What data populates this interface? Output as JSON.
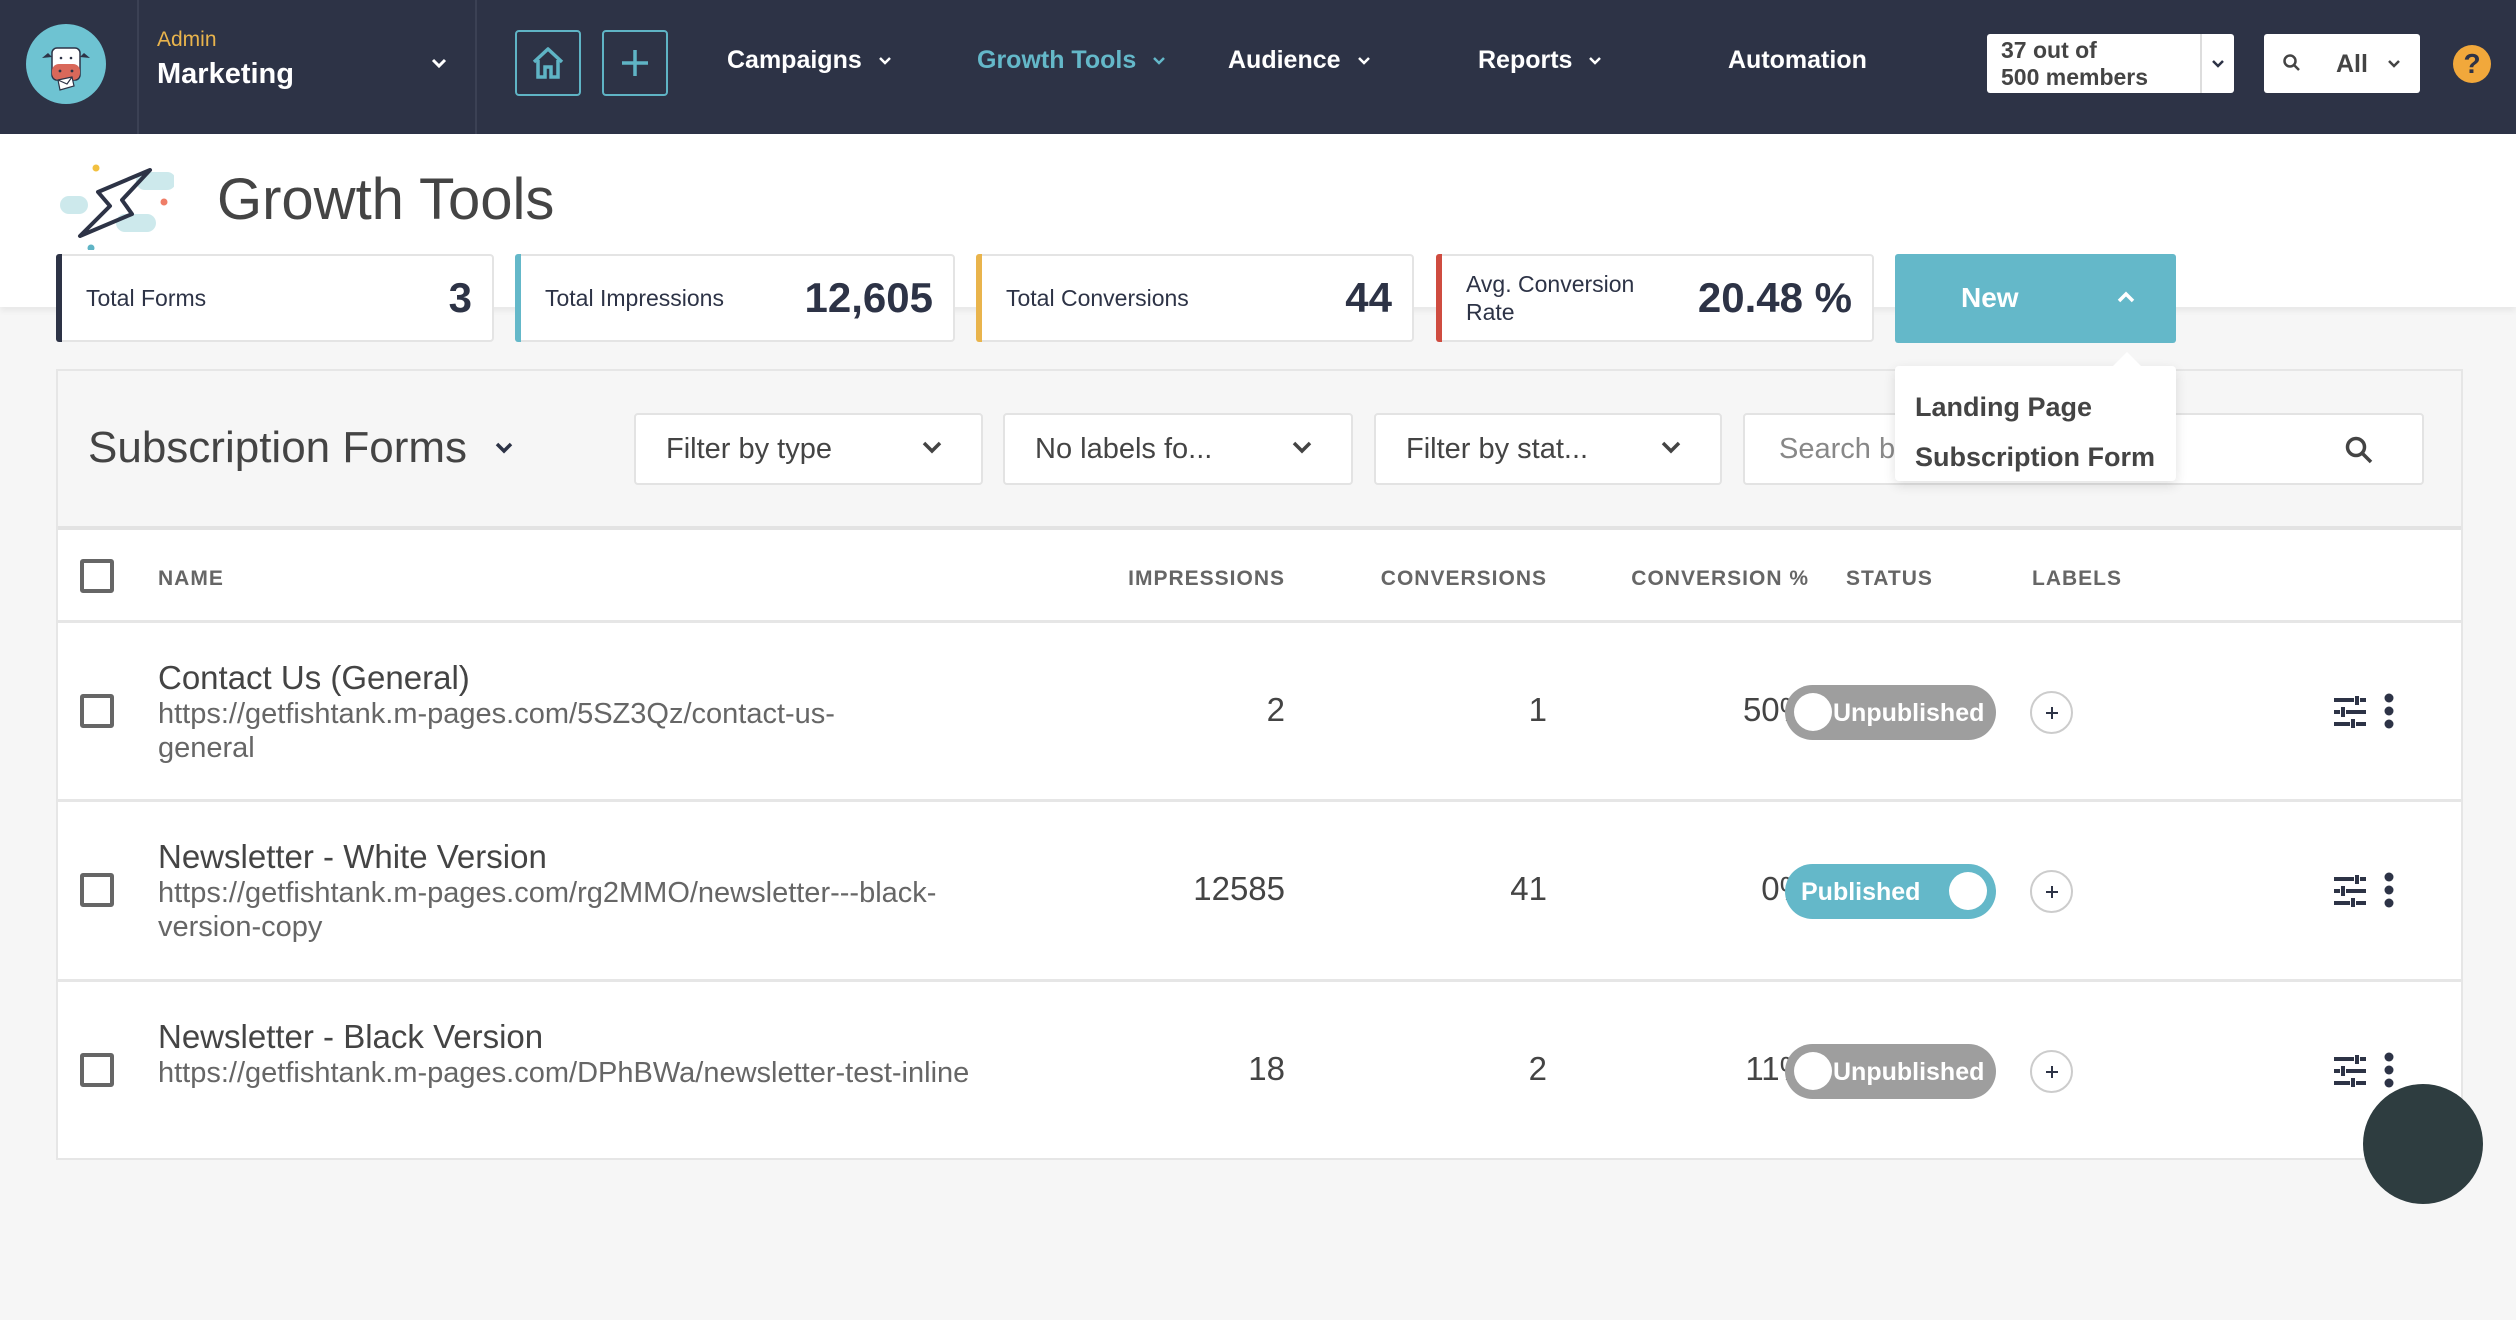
{
  "header": {
    "account_role": "Admin",
    "account_name": "Marketing",
    "nav": [
      {
        "label": "Campaigns",
        "has_dropdown": true,
        "active": false
      },
      {
        "label": "Growth Tools",
        "has_dropdown": true,
        "active": true
      },
      {
        "label": "Audience",
        "has_dropdown": true,
        "active": false
      },
      {
        "label": "Reports",
        "has_dropdown": true,
        "active": false
      },
      {
        "label": "Automation",
        "has_dropdown": false,
        "active": false
      }
    ],
    "members_line1": "37 out of",
    "members_line2": "500 members",
    "search_scope": "All",
    "help_glyph": "?",
    "icons": {
      "logo": "cow-mascot-icon",
      "home": "home-icon",
      "add": "plus-icon",
      "search": "search-icon",
      "help": "help-icon"
    }
  },
  "page": {
    "title": "Growth Tools",
    "icon": "lightning-bolt-icon"
  },
  "stats": [
    {
      "label": "Total Forms",
      "value": "3",
      "accent": "#2d3346"
    },
    {
      "label": "Total Impressions",
      "value": "12,605",
      "accent": "#64b8c9"
    },
    {
      "label": "Total Conversions",
      "value": "44",
      "accent": "#e9b44c"
    },
    {
      "label": "Avg. Conversion Rate",
      "value": "20.48 %",
      "accent": "#cf4c40"
    }
  ],
  "new_button": {
    "label": "New",
    "menu": [
      "Landing Page",
      "Subscription Form"
    ]
  },
  "panel": {
    "title": "Subscription Forms",
    "filters": [
      "Filter by type",
      "No labels fo...",
      "Filter by stat..."
    ],
    "search_placeholder": "Search by name"
  },
  "table": {
    "columns": [
      "NAME",
      "IMPRESSIONS",
      "CONVERSIONS",
      "CONVERSION %",
      "STATUS",
      "LABELS"
    ],
    "rows": [
      {
        "name": "Contact Us (General)",
        "url": "https://getfishtank.m-pages.com/5SZ3Qz/contact-us-general",
        "impressions": "2",
        "conversions": "1",
        "conversion_pct": "50%",
        "status": "Unpublished",
        "published": false
      },
      {
        "name": "Newsletter - White Version",
        "url": "https://getfishtank.m-pages.com/rg2MMO/newsletter---black-version-copy",
        "impressions": "12585",
        "conversions": "41",
        "conversion_pct": "0%",
        "status": "Published",
        "published": true
      },
      {
        "name": "Newsletter - Black Version",
        "url": "https://getfishtank.m-pages.com/DPhBWa/newsletter-test-inline",
        "impressions": "18",
        "conversions": "2",
        "conversion_pct": "11%",
        "status": "Unpublished",
        "published": false
      }
    ]
  },
  "colors": {
    "header_bg": "#2d3346",
    "accent_teal": "#64b8c9",
    "admin_gold": "#e9b44c",
    "help_orange": "#f1a83b",
    "toggle_off": "#9e9e9e",
    "fab": "#2e3d40"
  }
}
